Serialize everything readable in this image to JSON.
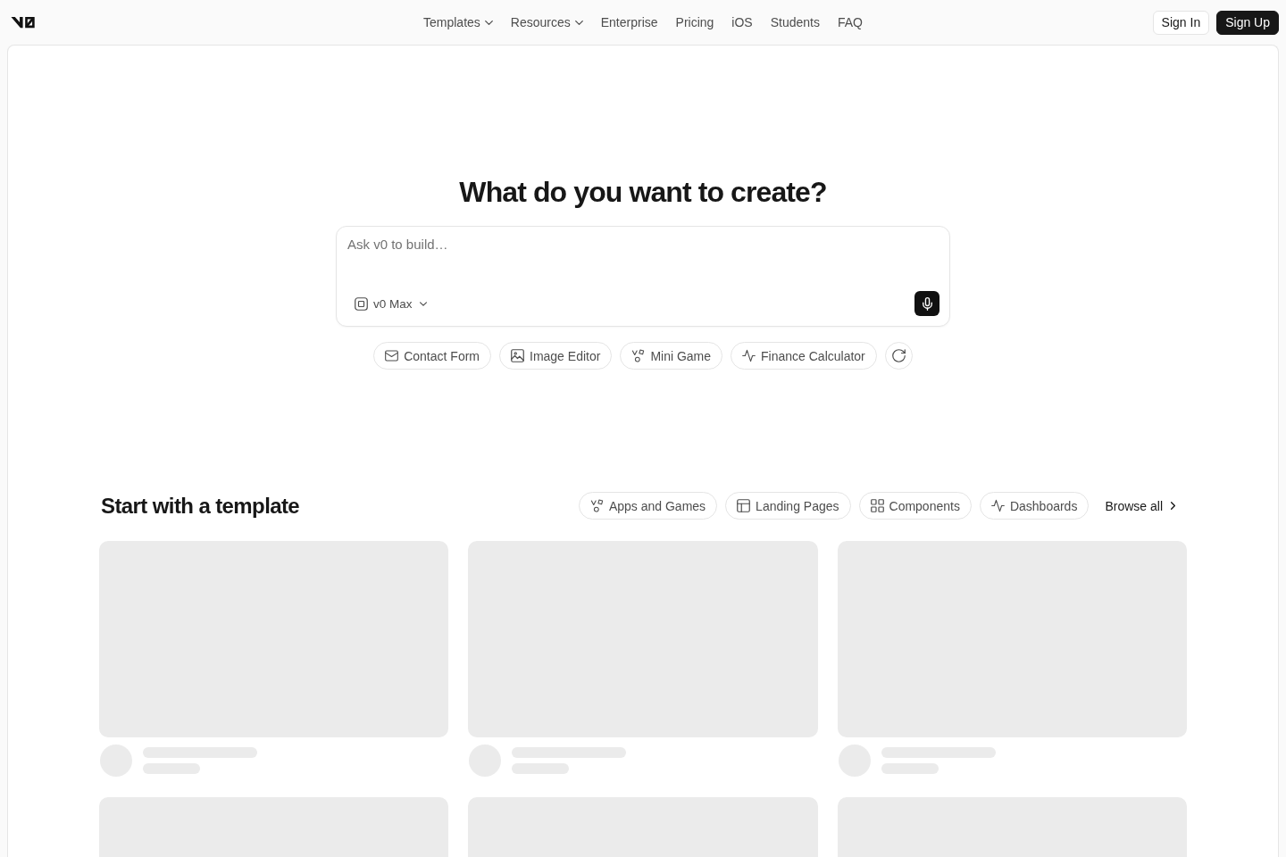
{
  "header": {
    "nav": [
      {
        "label": "Templates",
        "dropdown": true
      },
      {
        "label": "Resources",
        "dropdown": true
      },
      {
        "label": "Enterprise",
        "dropdown": false
      },
      {
        "label": "Pricing",
        "dropdown": false
      },
      {
        "label": "iOS",
        "dropdown": false
      },
      {
        "label": "Students",
        "dropdown": false
      },
      {
        "label": "FAQ",
        "dropdown": false
      }
    ],
    "buttons": [
      {
        "label": "Sign In",
        "kind": "outline"
      },
      {
        "label": "Sign Up",
        "kind": "solid"
      }
    ]
  },
  "hero": {
    "title": "What do you want to create?",
    "prompt": {
      "placeholder": "Ask v0 to build…",
      "model": "v0 Max"
    },
    "suggestions": [
      "Contact Form",
      "Image Editor",
      "Mini Game",
      "Finance Calculator"
    ]
  },
  "templates": {
    "title": "Start with a template",
    "categories": [
      "Apps and Games",
      "Landing Pages",
      "Components",
      "Dashboards"
    ],
    "browse_all": "Browse all",
    "cards": [
      {
        "loading": true
      },
      {
        "loading": true
      },
      {
        "loading": true
      },
      {
        "loading": true
      },
      {
        "loading": true
      },
      {
        "loading": true
      }
    ]
  }
}
